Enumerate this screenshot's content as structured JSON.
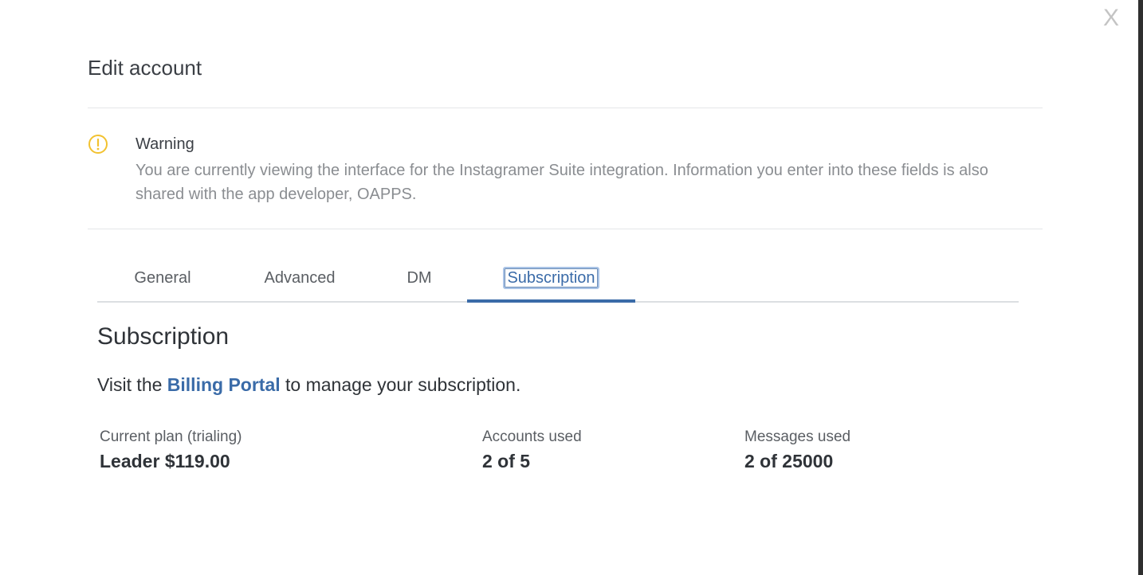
{
  "modal": {
    "close_label": "X",
    "title": "Edit account"
  },
  "warning": {
    "icon": "warning-circle-icon",
    "icon_color": "#f2c230",
    "title": "Warning",
    "body": "You are currently viewing the interface for the Instagramer Suite integration. Information you enter into these fields is also shared with the app developer, OAPPS."
  },
  "tabs": [
    {
      "label": "General",
      "active": false
    },
    {
      "label": "Advanced",
      "active": false
    },
    {
      "label": "DM",
      "active": false
    },
    {
      "label": "Subscription",
      "active": true
    }
  ],
  "subscription": {
    "heading": "Subscription",
    "visit_prefix": "Visit the ",
    "portal_link": "Billing Portal",
    "visit_suffix": " to manage your subscription.",
    "stats": [
      {
        "label": "Current plan (trialing)",
        "value": "Leader $119.00"
      },
      {
        "label": "Accounts used",
        "value": "2 of 5"
      },
      {
        "label": "Messages used",
        "value": "2 of 25000"
      }
    ]
  },
  "colors": {
    "accent": "#3a6ba8",
    "warning": "#f2c230"
  }
}
